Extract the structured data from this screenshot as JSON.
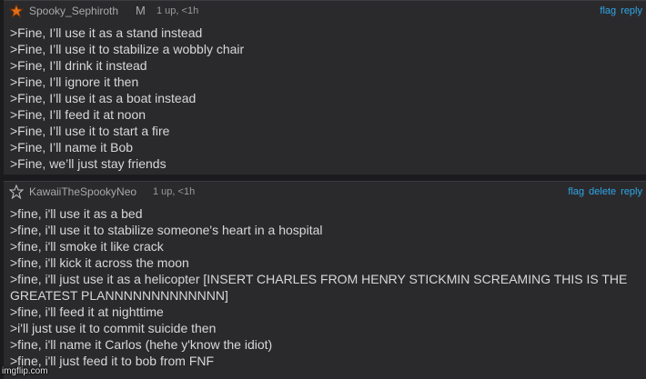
{
  "comments": [
    {
      "username": "Spooky_Sephiroth",
      "flair": "M",
      "meta": "1 up, <1h",
      "links": [
        "flag",
        "reply"
      ],
      "lines": [
        ">Fine, I’ll use it as a stand instead",
        ">Fine, I’ll use it to stabilize a wobbly chair",
        ">Fine, I’ll drink it instead",
        ">Fine, I’ll ignore it then",
        ">Fine, I’ll use it as a boat instead",
        ">Fine, I’ll feed it at noon",
        ">Fine, I’ll use it to start a fire",
        ">Fine, I’ll name it Bob",
        ">Fine, we’ll just stay friends"
      ]
    },
    {
      "username": "KawaiiTheSpookyNeo",
      "meta": "1 up, <1h",
      "links": [
        "flag",
        "delete",
        "reply"
      ],
      "lines": [
        ">fine, i'll use it as a bed",
        ">fine, i'll use it to stabilize someone's heart in a hospital",
        ">fine, i'll smoke it like crack",
        ">fine, i'll kick it across the moon",
        ">fine, i'll just use it as a helicopter [INSERT CHARLES FROM HENRY STICKMIN SCREAMING THIS IS THE GREATEST PLANNNNNNNNNNNNN]",
        ">fine, i'll feed it at nighttime",
        ">i'll just use it to commit suicide then",
        ">fine, i'll name it Carlos (hehe y'know the idiot)",
        ">fine, i'll just feed it to bob from FNF"
      ]
    }
  ],
  "icons": {
    "c1": "orange-star-icon",
    "c2": "outline-star-icon"
  },
  "colors": {
    "link": "#2fa7e8",
    "background": "#2a2a2d",
    "text": "#d8d8d8"
  },
  "watermark": "imgflip.com"
}
